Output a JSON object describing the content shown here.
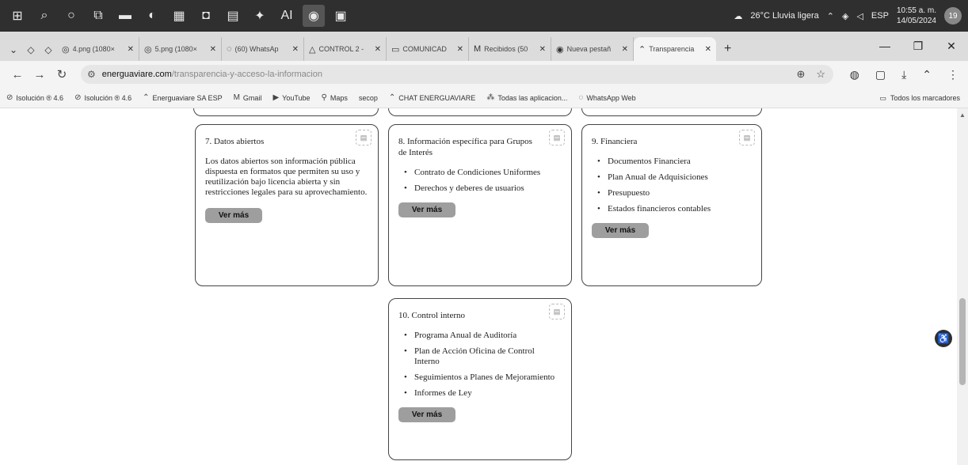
{
  "taskbar": {
    "icons": [
      "windows-icon",
      "search-icon",
      "cortana-icon",
      "task-view-icon",
      "file-explorer-icon",
      "browser-icon",
      "excel-icon",
      "app-icon",
      "word-icon",
      "teams-icon",
      "ai-icon",
      "chrome-icon",
      "photos-icon"
    ],
    "ai_label": "AI",
    "weather": "26°C Lluvia ligera",
    "lang": "ESP",
    "time": "10:55 a. m.",
    "date": "14/05/2024",
    "notifications": "19"
  },
  "tabs": [
    {
      "label": "4.png (1080×",
      "icon": "globe-icon",
      "active": false
    },
    {
      "label": "5.png (1080×",
      "icon": "globe-icon",
      "active": false
    },
    {
      "label": "(60) WhatsAp",
      "icon": "whatsapp-icon",
      "active": false
    },
    {
      "label": "CONTROL 2 -",
      "icon": "drive-icon",
      "active": false
    },
    {
      "label": "COMUNICAD",
      "icon": "classroom-icon",
      "active": false
    },
    {
      "label": "Recibidos (50",
      "icon": "gmail-icon",
      "active": false
    },
    {
      "label": "Nueva pestañ",
      "icon": "chrome-icon",
      "active": false
    },
    {
      "label": "Transparencia",
      "icon": "site-icon",
      "active": true
    }
  ],
  "address": {
    "host": "energuaviare.com",
    "path": "/transparencia-y-acceso-la-informacion"
  },
  "bookmarks": [
    {
      "label": "Isolución ® 4.6",
      "icon": "isolucion-icon"
    },
    {
      "label": "Isolución ® 4.6",
      "icon": "isolucion-icon"
    },
    {
      "label": "Energuaviare SA ESP",
      "icon": "site-icon"
    },
    {
      "label": "Gmail",
      "icon": "gmail-icon"
    },
    {
      "label": "YouTube",
      "icon": "youtube-icon"
    },
    {
      "label": "Maps",
      "icon": "maps-icon"
    },
    {
      "label": "secop",
      "icon": ""
    },
    {
      "label": "CHAT ENERGUAVIARE",
      "icon": "site-icon"
    },
    {
      "label": "Todas las aplicacion...",
      "icon": "apps-icon"
    },
    {
      "label": "WhatsApp Web",
      "icon": "whatsapp-icon"
    }
  ],
  "bookmarks_all": "Todos los marcadores",
  "cards": {
    "datos_abiertos": {
      "title": "7. Datos abiertos",
      "text": "Los datos abiertos son información pública dispuesta en formatos que permiten su uso y reutilización bajo licencia abierta y sin restricciones legales para su aprovechamiento.",
      "button": "Ver más"
    },
    "grupos_interes": {
      "title": "8. Información específica para Grupos de Interés",
      "items": [
        "Contrato de Condiciones Uniformes",
        "Derechos y deberes de usuarios"
      ],
      "button": "Ver más"
    },
    "financiera": {
      "title": "9. Financiera",
      "items": [
        "Documentos Financiera",
        "Plan Anual de Adquisiciones",
        "Presupuesto",
        "Estados financieros contables"
      ],
      "button": "Ver más"
    },
    "control_interno": {
      "title": "10. Control interno",
      "items": [
        "Programa Anual de Auditoría",
        "Plan de Acción Oficina de Control Interno",
        "Seguimientos a Planes de Mejoramiento",
        "Informes de Ley"
      ],
      "button": "Ver más"
    }
  }
}
